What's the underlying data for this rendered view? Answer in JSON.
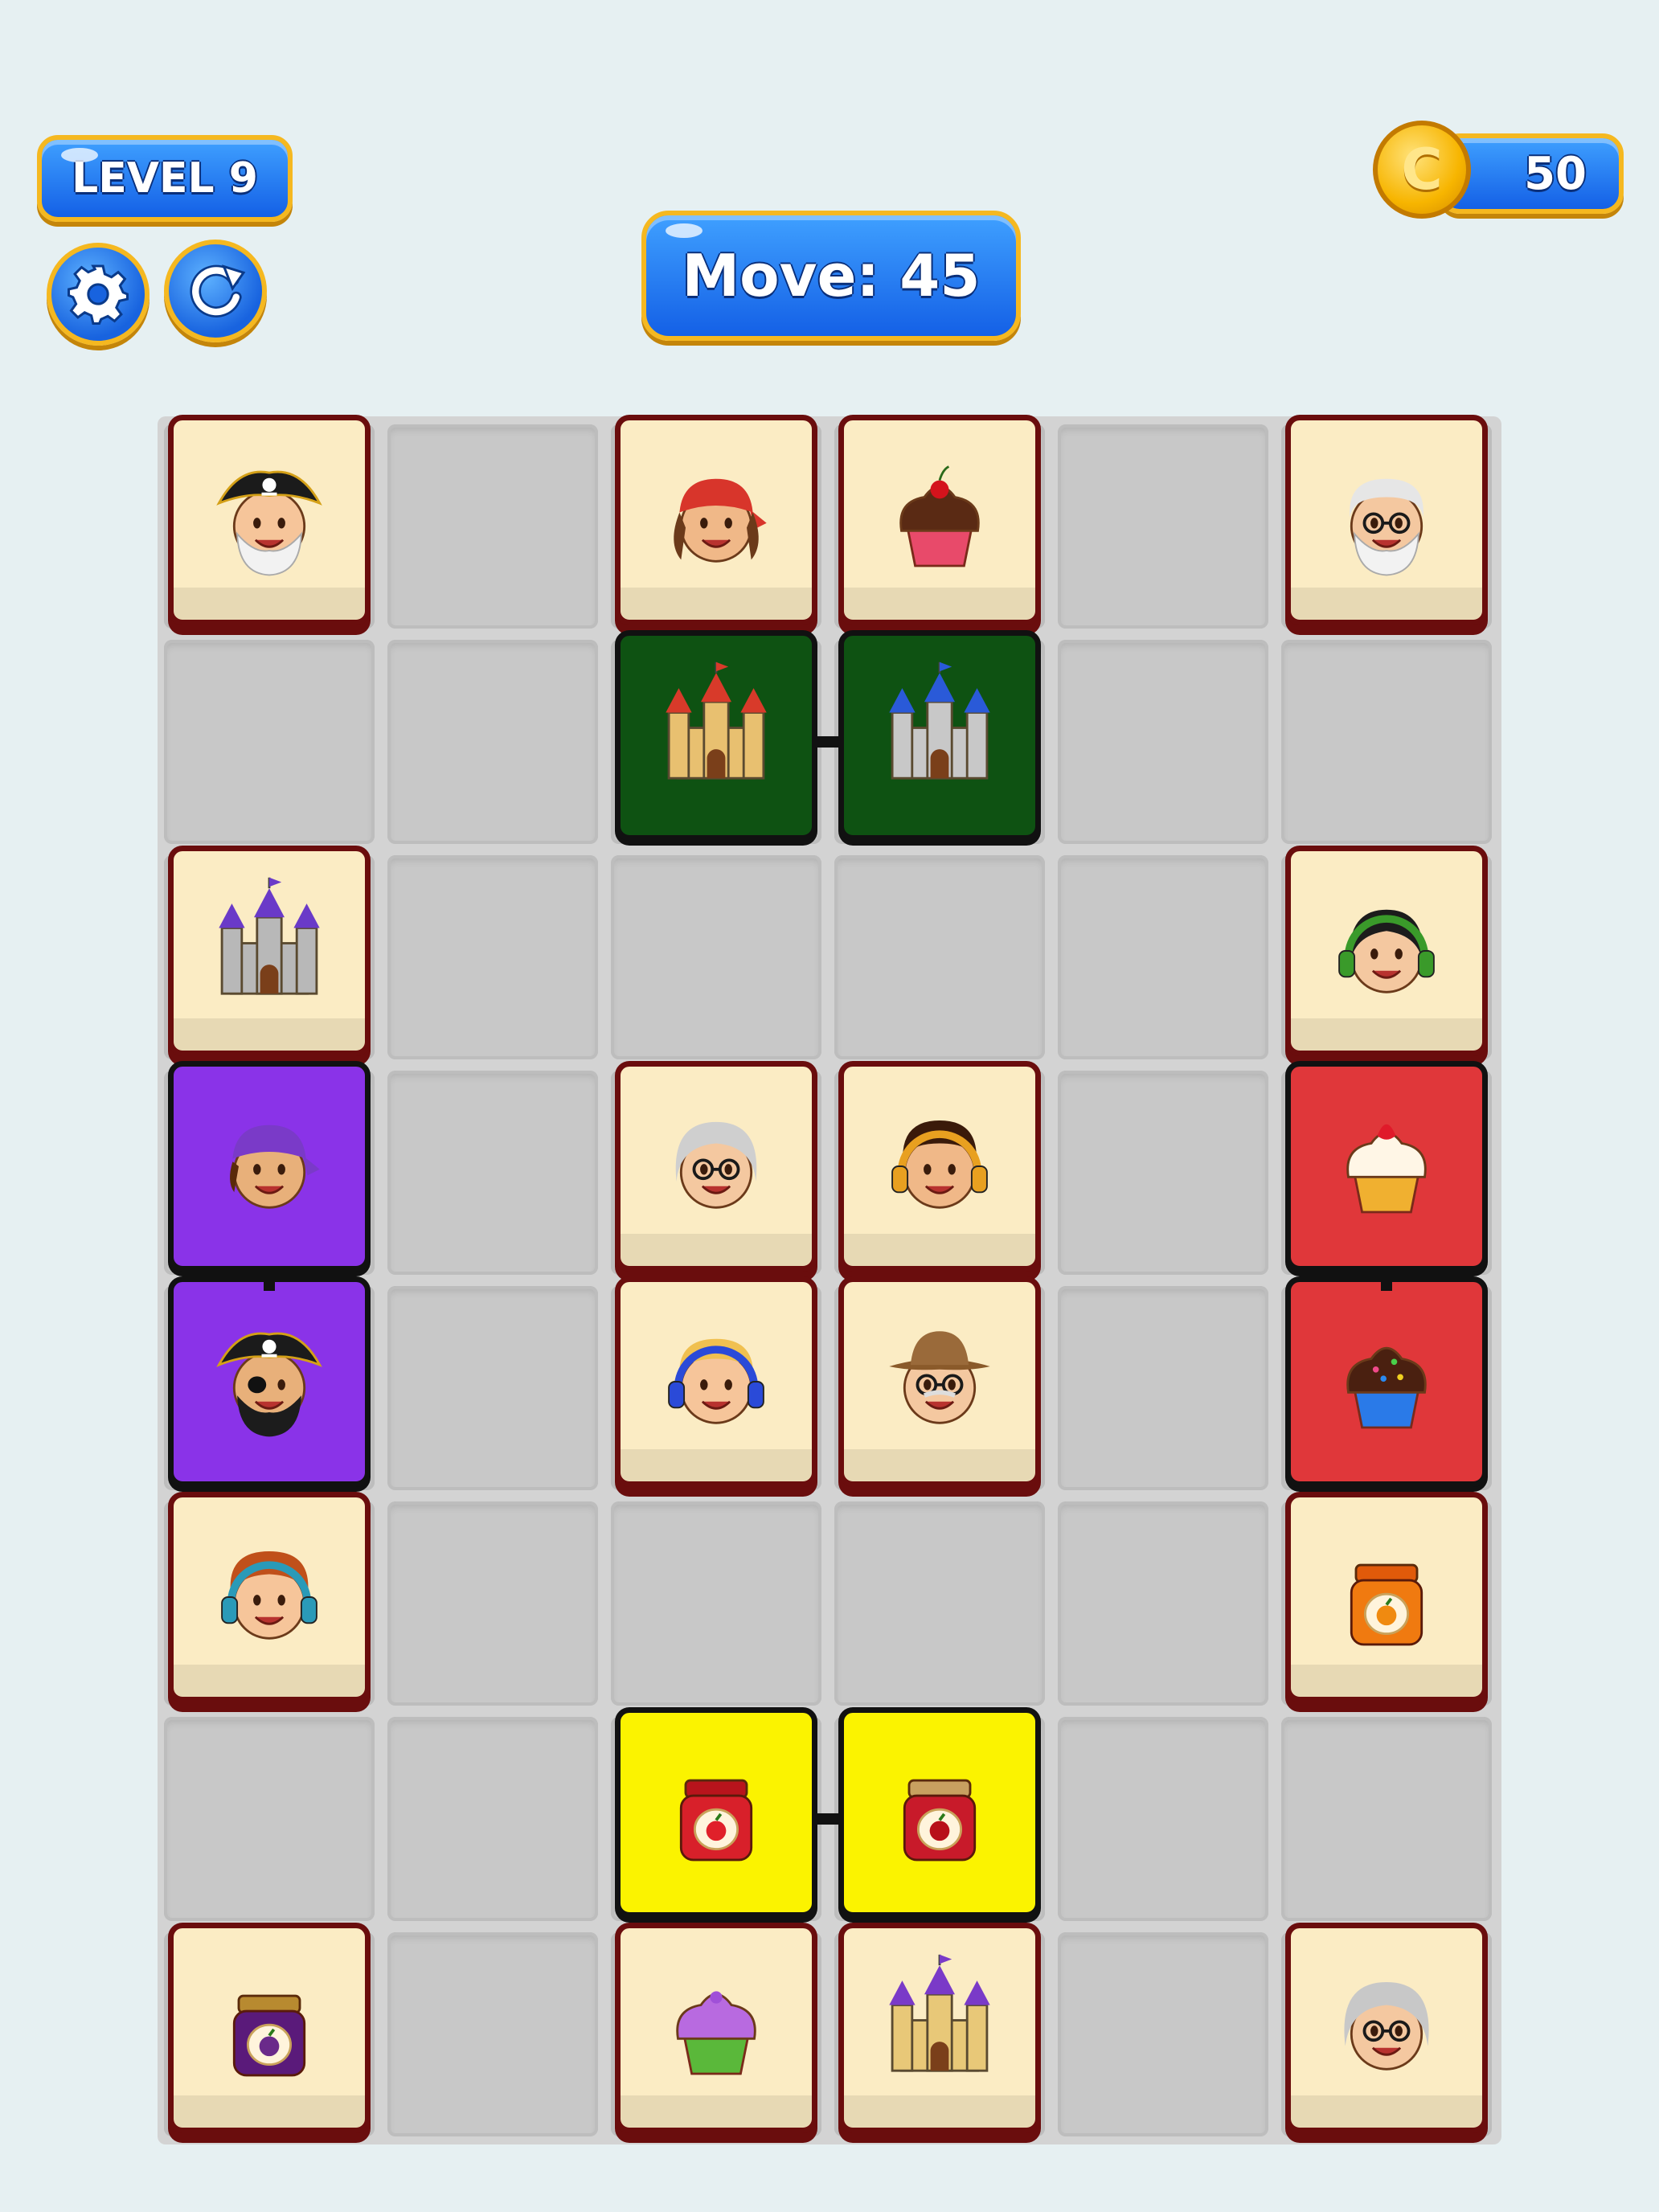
{
  "hud": {
    "level_label": "LEVEL 9",
    "moves_label": "Move: 45",
    "coins": "50",
    "coin_symbol": "C"
  },
  "colors": {
    "blue_button": "#1f6fff",
    "gold_border": "#f5b820",
    "tile_cream": "#fbecc4",
    "tile_border": "#6a0d0d",
    "green_pair": "#0e5212",
    "purple_pair": "#8a33e8",
    "red_pair": "#e0373a",
    "yellow_pair": "#fbf300"
  },
  "board": {
    "columns": 6,
    "rows": 8,
    "tiles": [
      {
        "row": 0,
        "col": 0,
        "icon": "pirate-captain-icon"
      },
      {
        "row": 0,
        "col": 2,
        "icon": "bandana-girl-icon"
      },
      {
        "row": 0,
        "col": 3,
        "icon": "cherry-cupcake-icon"
      },
      {
        "row": 0,
        "col": 5,
        "icon": "grandpa-glasses-icon"
      },
      {
        "row": 1,
        "col": 2,
        "icon": "red-castle-icon",
        "highlight": "green"
      },
      {
        "row": 1,
        "col": 3,
        "icon": "blue-castle-icon",
        "highlight": "green"
      },
      {
        "row": 2,
        "col": 0,
        "icon": "purple-castle-icon"
      },
      {
        "row": 2,
        "col": 5,
        "icon": "headphones-girl-icon"
      },
      {
        "row": 3,
        "col": 0,
        "icon": "purple-bandana-pirate-icon",
        "highlight": "purple"
      },
      {
        "row": 3,
        "col": 2,
        "icon": "grandma-glasses-icon"
      },
      {
        "row": 3,
        "col": 3,
        "icon": "headphones-boy-icon"
      },
      {
        "row": 3,
        "col": 5,
        "icon": "strawberry-cupcake-icon",
        "highlight": "red"
      },
      {
        "row": 4,
        "col": 0,
        "icon": "eyepatch-pirate-icon",
        "highlight": "purple"
      },
      {
        "row": 4,
        "col": 2,
        "icon": "blue-headphones-kid-icon"
      },
      {
        "row": 4,
        "col": 3,
        "icon": "hat-grandpa-icon"
      },
      {
        "row": 4,
        "col": 5,
        "icon": "chocolate-cupcake-icon",
        "highlight": "red"
      },
      {
        "row": 5,
        "col": 0,
        "icon": "curly-headphones-boy-icon"
      },
      {
        "row": 5,
        "col": 5,
        "icon": "orange-jam-icon"
      },
      {
        "row": 6,
        "col": 2,
        "icon": "strawberry-jam-icon",
        "highlight": "yellow"
      },
      {
        "row": 6,
        "col": 3,
        "icon": "cherry-jam-icon",
        "highlight": "yellow"
      },
      {
        "row": 7,
        "col": 0,
        "icon": "plum-jam-icon"
      },
      {
        "row": 7,
        "col": 2,
        "icon": "purple-cupcake-icon"
      },
      {
        "row": 7,
        "col": 3,
        "icon": "sand-castle-icon"
      },
      {
        "row": 7,
        "col": 5,
        "icon": "grandma-curly-icon"
      }
    ],
    "links": [
      {
        "from": [
          1,
          2
        ],
        "to": [
          1,
          3
        ]
      },
      {
        "from": [
          3,
          0
        ],
        "to": [
          4,
          0
        ]
      },
      {
        "from": [
          3,
          5
        ],
        "to": [
          4,
          5
        ]
      },
      {
        "from": [
          6,
          2
        ],
        "to": [
          6,
          3
        ]
      }
    ]
  }
}
